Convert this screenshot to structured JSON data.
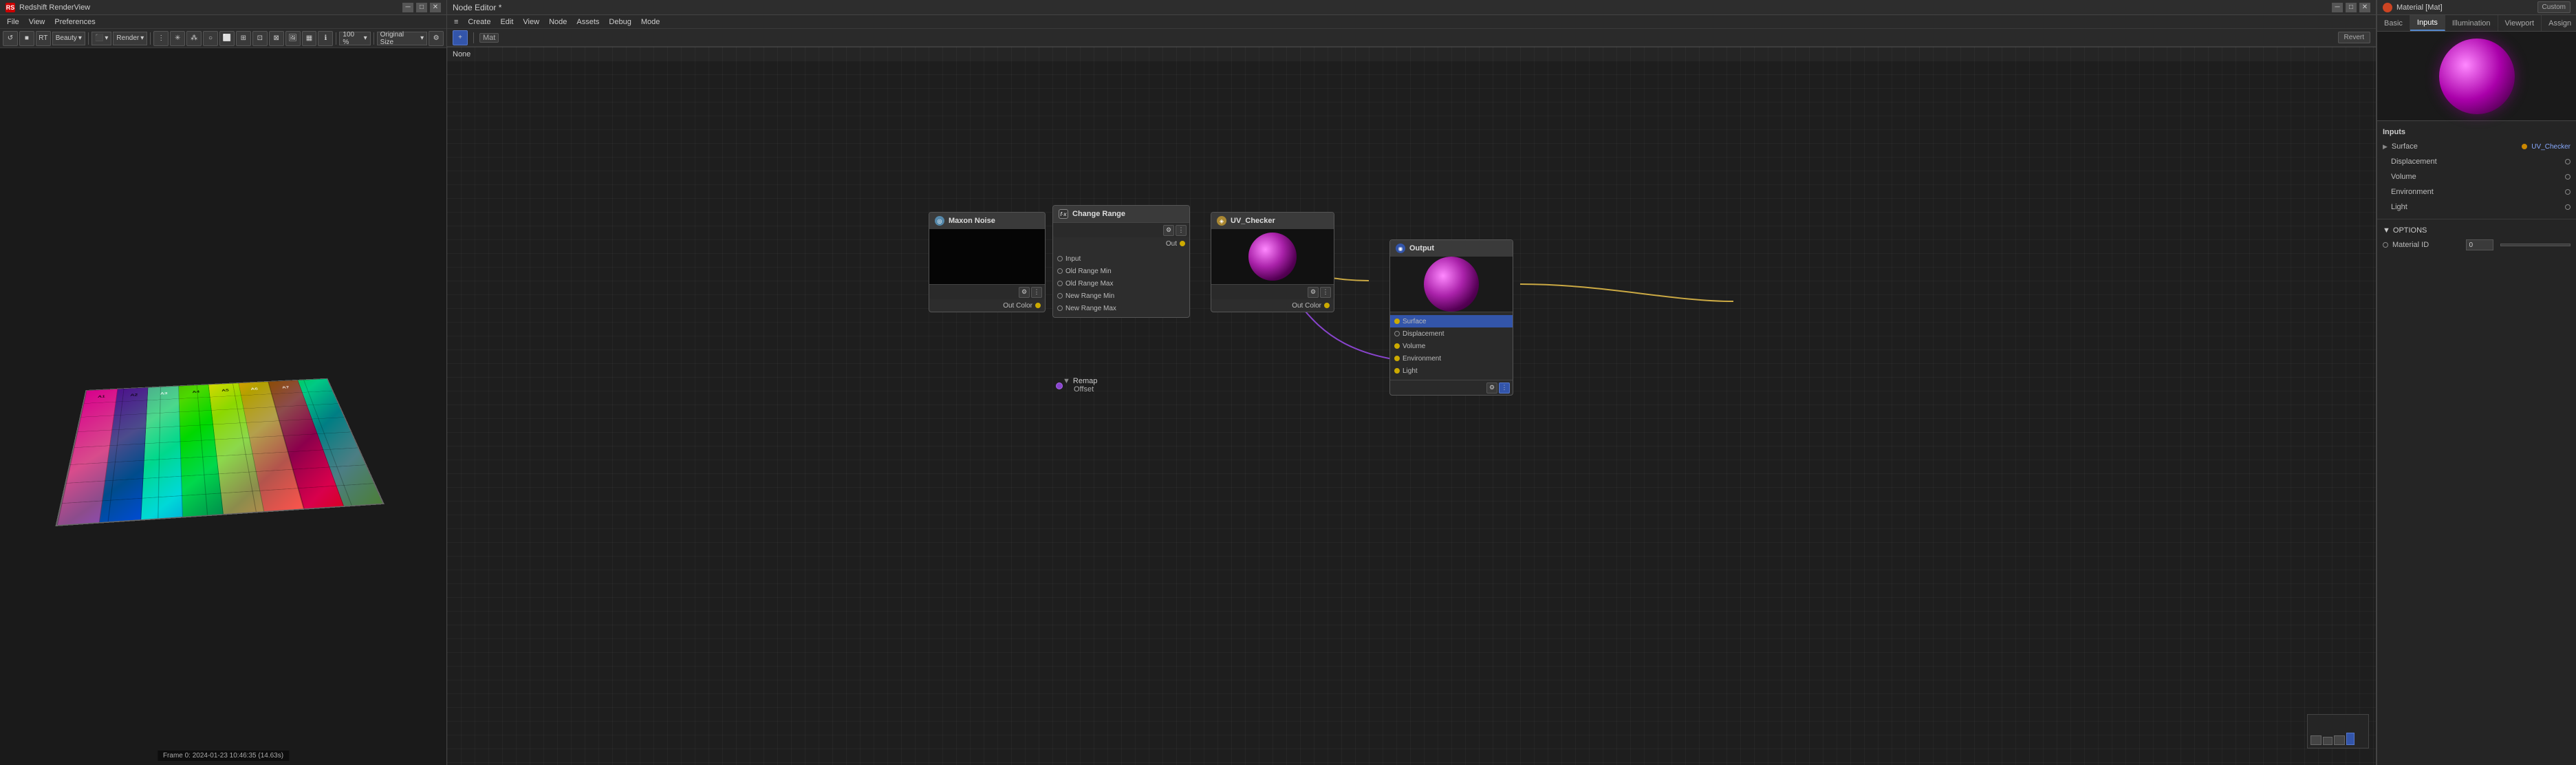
{
  "renderView": {
    "title": "Redshift RenderView",
    "menuItems": [
      "File",
      "View",
      "Preferences"
    ],
    "toolbar": {
      "renderBtn": "Render",
      "beautyLabel": "Beauty",
      "zoomLabel": "100 %",
      "sizeLabel": "Original Size"
    },
    "frameInfo": "Frame  0:  2024-01-23  10:46:35  (14.63s)"
  },
  "nodeEditor": {
    "title": "Node Editor *",
    "menuItems": [
      "≡",
      "Create",
      "Edit",
      "View",
      "Node",
      "Assets",
      "Debug",
      "Mode"
    ],
    "tabLabel": "Mat",
    "revertBtn": "Revert",
    "statusBar": "None",
    "nodes": {
      "maxonNoise": {
        "title": "Maxon Noise",
        "outputLabel": "Out Color"
      },
      "changeRange": {
        "title": "Change Range",
        "outputLabel": "Out",
        "inputLabels": [
          "Input",
          "Old Range Min",
          "Old Range Max",
          "New Range Min",
          "New Range Max"
        ]
      },
      "uvChecker": {
        "title": "UV_Checker",
        "outputLabel": "Out Color"
      },
      "output": {
        "title": "Output",
        "inputLabels": [
          "Surface",
          "Displacement",
          "Volume",
          "Environment",
          "Light"
        ]
      }
    },
    "remapSection": {
      "label": "Remap",
      "offsetLabel": "Offset"
    }
  },
  "materialPanel": {
    "title": "Material [Mat]",
    "customBadge": "Custom",
    "tabs": [
      "Basic",
      "Inputs",
      "Illumination",
      "Viewport",
      "Assign"
    ],
    "activeTab": "Inputs",
    "inputs": {
      "sectionLabel": "Inputs",
      "surface": {
        "label": "Surface",
        "value": "UV_Checker"
      },
      "displacement": {
        "label": "Displacement"
      },
      "volume": {
        "label": "Volume"
      },
      "environment": {
        "label": "Environment"
      },
      "light": {
        "label": "Light"
      }
    },
    "options": {
      "sectionLabel": "OPTIONS",
      "materialId": {
        "label": "Material ID",
        "value": "0"
      }
    },
    "assignBtn": "Assign"
  },
  "colors": {
    "accent": "#5588cc",
    "nodeHeaderBg": "#3a3a3a",
    "portYellow": "#ccaa00",
    "portBlue": "#4488cc",
    "portPurple": "#8844cc",
    "connectionLine": "#ccaa44"
  },
  "icons": {
    "noiseIcon": "◎",
    "fxIcon": "fx",
    "textureIcon": "◈",
    "outputIcon": "◉",
    "arrowRight": "▶",
    "arrowDown": "▼",
    "checkmark": "✓",
    "close": "✕",
    "minimize": "─",
    "maximize": "□",
    "hamburger": "≡",
    "plus": "+",
    "circle": "●"
  }
}
